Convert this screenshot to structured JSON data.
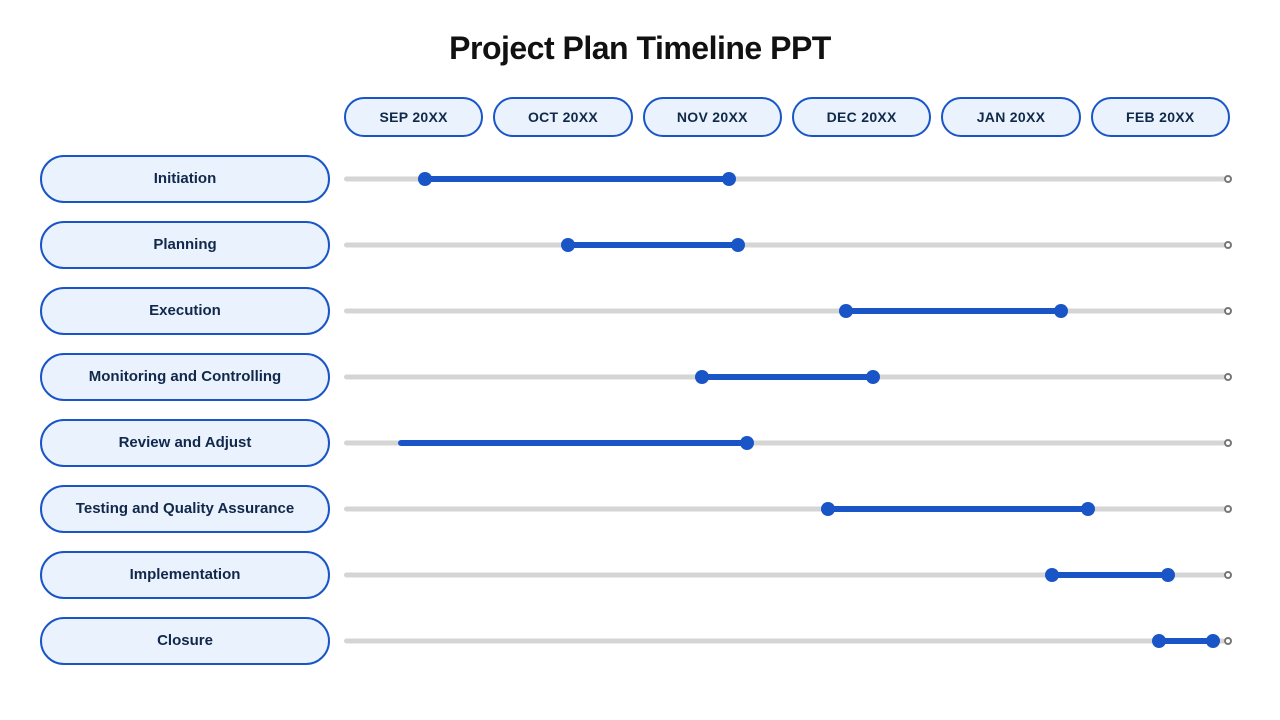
{
  "title": "Project Plan Timeline PPT",
  "months": [
    "SEP 20XX",
    "OCT 20XX",
    "NOV 20XX",
    "DEC 20XX",
    "JAN 20XX",
    "FEB 20XX"
  ],
  "rows": [
    {
      "label": "Initiation",
      "start": 9,
      "end": 43,
      "no_start_cap": false
    },
    {
      "label": "Planning",
      "start": 25,
      "end": 44,
      "no_start_cap": false
    },
    {
      "label": "Execution",
      "start": 56,
      "end": 80,
      "no_start_cap": false
    },
    {
      "label": "Monitoring and Controlling",
      "start": 40,
      "end": 59,
      "no_start_cap": false
    },
    {
      "label": "Review and Adjust",
      "start": 6,
      "end": 45,
      "no_start_cap": true
    },
    {
      "label": "Testing and Quality Assurance",
      "start": 54,
      "end": 83,
      "no_start_cap": false
    },
    {
      "label": "Implementation",
      "start": 79,
      "end": 92,
      "no_start_cap": false
    },
    {
      "label": "Closure",
      "start": 91,
      "end": 97,
      "no_start_cap": false
    }
  ],
  "chart_data": {
    "type": "bar",
    "title": "Project Plan Timeline PPT",
    "categories": [
      "SEP 20XX",
      "OCT 20XX",
      "NOV 20XX",
      "DEC 20XX",
      "JAN 20XX",
      "FEB 20XX"
    ],
    "series": [
      {
        "name": "Initiation",
        "start_pct": 9,
        "end_pct": 43
      },
      {
        "name": "Planning",
        "start_pct": 25,
        "end_pct": 44
      },
      {
        "name": "Execution",
        "start_pct": 56,
        "end_pct": 80
      },
      {
        "name": "Monitoring and Controlling",
        "start_pct": 40,
        "end_pct": 59
      },
      {
        "name": "Review and Adjust",
        "start_pct": 6,
        "end_pct": 45
      },
      {
        "name": "Testing and Quality Assurance",
        "start_pct": 54,
        "end_pct": 83
      },
      {
        "name": "Implementation",
        "start_pct": 79,
        "end_pct": 92
      },
      {
        "name": "Closure",
        "start_pct": 91,
        "end_pct": 97
      }
    ],
    "xlabel": "",
    "ylabel": "",
    "ylim": [
      0,
      100
    ]
  }
}
